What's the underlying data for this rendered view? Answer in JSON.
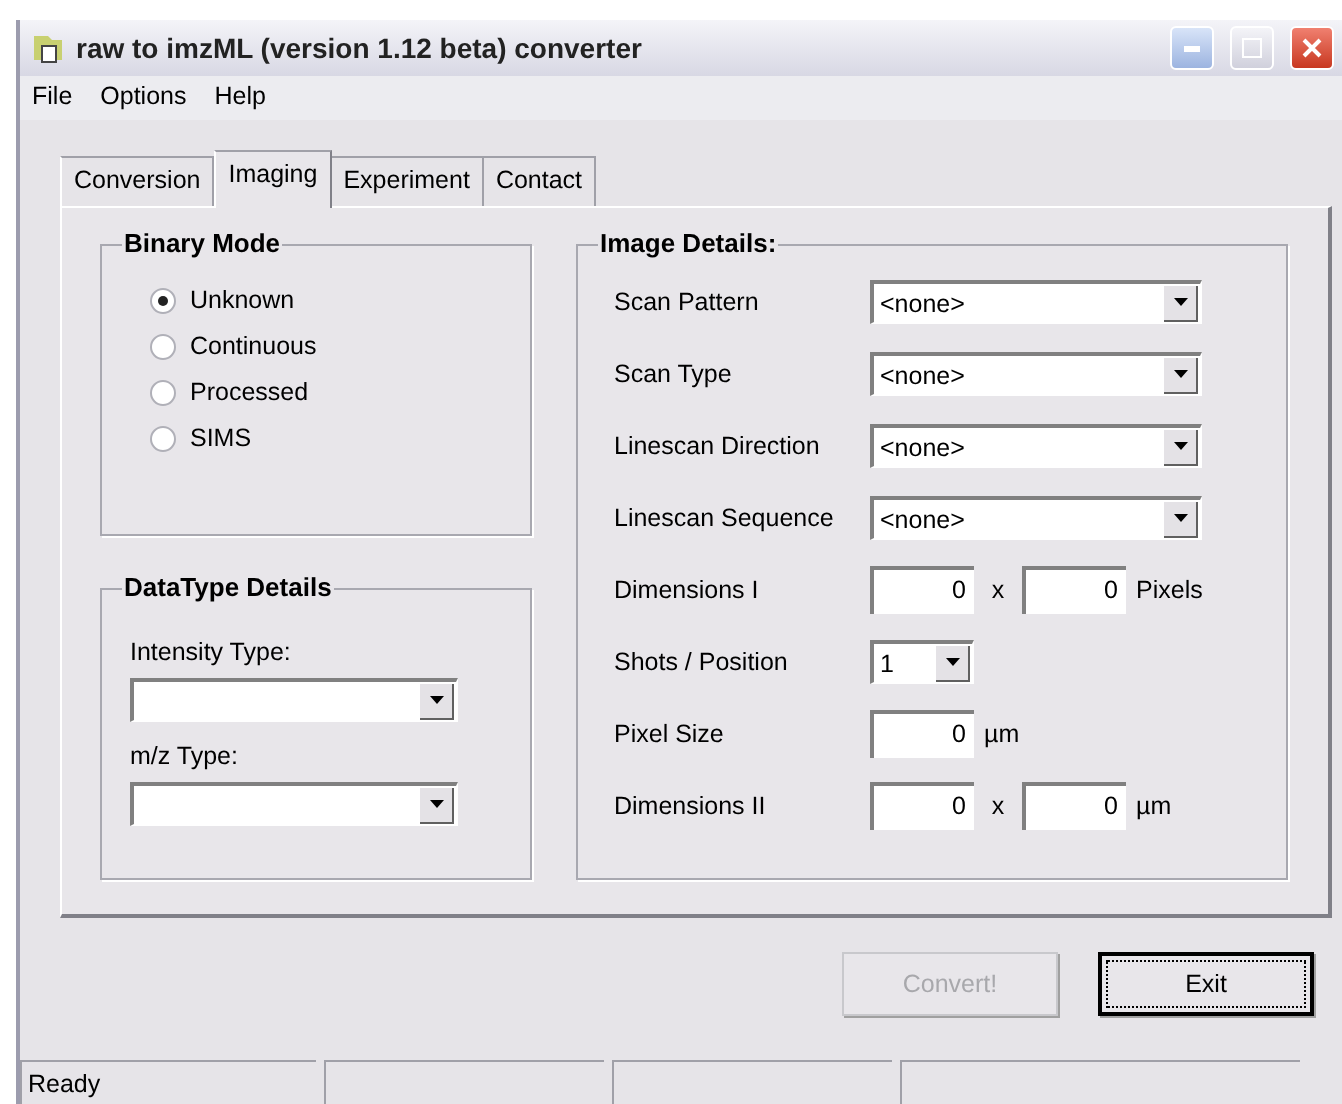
{
  "window": {
    "title": "raw to imzML (version 1.12 beta) converter"
  },
  "menu": [
    {
      "label": "File"
    },
    {
      "label": "Options"
    },
    {
      "label": "Help"
    }
  ],
  "tabs": [
    {
      "label": "Conversion",
      "selected": false
    },
    {
      "label": "Imaging",
      "selected": true
    },
    {
      "label": "Experiment",
      "selected": false
    },
    {
      "label": "Contact",
      "selected": false
    }
  ],
  "binary_mode": {
    "title": "Binary Mode",
    "options": [
      {
        "label": "Unknown",
        "selected": true
      },
      {
        "label": "Continuous",
        "selected": false
      },
      {
        "label": "Processed",
        "selected": false
      },
      {
        "label": "SIMS",
        "selected": false
      }
    ]
  },
  "datatype_details": {
    "title": "DataType Details",
    "fields": [
      {
        "label": "Intensity Type:"
      },
      {
        "label": "m/z Type:"
      }
    ]
  },
  "image_details": {
    "title": "Image Details:",
    "fields": [
      {
        "kind": "dropdown",
        "label": "Scan Pattern",
        "value": "<none>"
      },
      {
        "kind": "dropdown",
        "label": "Scan Type",
        "value": "<none>"
      },
      {
        "kind": "dropdown",
        "label": "Linescan Direction",
        "value": "<none>"
      },
      {
        "kind": "dropdown",
        "label": "Linescan Sequence",
        "value": "<none>"
      },
      {
        "kind": "pair",
        "label": "Dimensions I",
        "value_a": "0",
        "separator": "x",
        "value_b": "0",
        "unit": "Pixels"
      },
      {
        "kind": "small_dropdown",
        "label": "Shots / Position",
        "value": "1"
      },
      {
        "kind": "single",
        "label": "Pixel Size",
        "value": "0",
        "unit": "µm"
      },
      {
        "kind": "pair",
        "label": "Dimensions II",
        "value_a": "0",
        "separator": "x",
        "value_b": "0",
        "unit": "µm"
      }
    ]
  },
  "buttons": [
    {
      "label": "Convert!",
      "disabled": true,
      "focused": false
    },
    {
      "label": "Exit",
      "disabled": false,
      "focused": true
    }
  ],
  "status_bar": {
    "text": "Ready"
  }
}
